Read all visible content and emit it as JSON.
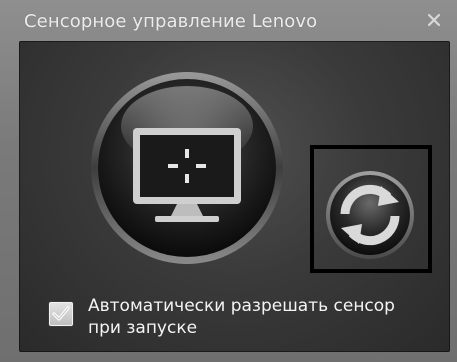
{
  "window": {
    "title": "Сенсорное управление Lenovo",
    "close_icon": "close-icon"
  },
  "main": {
    "touch_control_icon": "monitor-crosshair-icon",
    "refresh_icon": "refresh-icon"
  },
  "options": {
    "auto_enable_label": "Автоматически разрешать сенсор при запуске",
    "auto_enable_checked": true
  },
  "colors": {
    "window_chrome": "#7a7a7a",
    "panel_background": "#333333",
    "highlight_frame": "#000000",
    "text": "#f4f4f4"
  }
}
